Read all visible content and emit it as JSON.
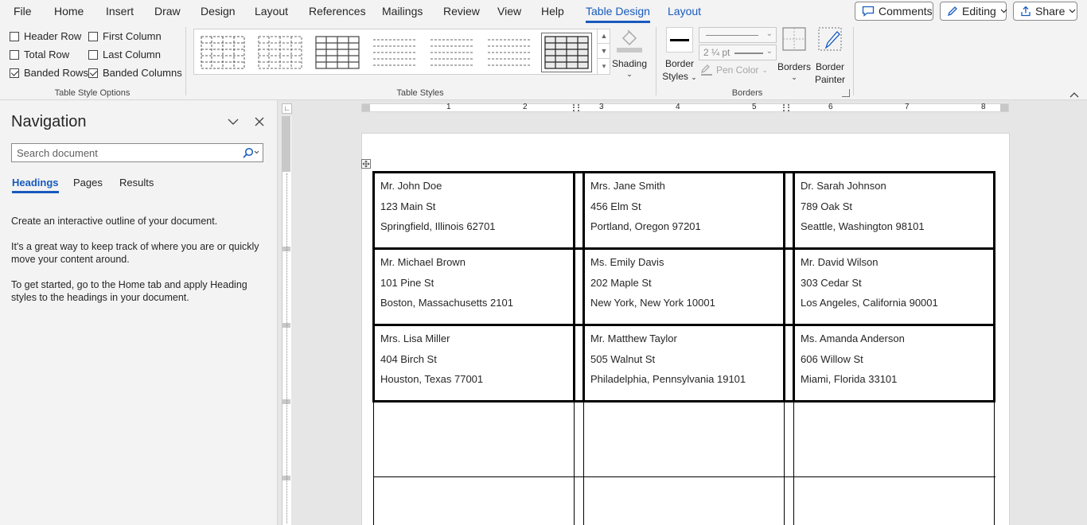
{
  "menu": {
    "items": [
      "File",
      "Home",
      "Insert",
      "Draw",
      "Design",
      "Layout",
      "References",
      "Mailings",
      "Review",
      "View",
      "Help",
      "Table Design",
      "Layout"
    ],
    "active_index": 11,
    "comments_label": "Comments",
    "editing_label": "Editing",
    "share_label": "Share"
  },
  "ribbon": {
    "options": [
      {
        "label": "Header Row",
        "checked": false
      },
      {
        "label": "First Column",
        "checked": false
      },
      {
        "label": "Total Row",
        "checked": false
      },
      {
        "label": "Last Column",
        "checked": false
      },
      {
        "label": "Banded Rows",
        "checked": true
      },
      {
        "label": "Banded Columns",
        "checked": true
      }
    ],
    "group_table_style_options": "Table Style Options",
    "group_table_styles": "Table Styles",
    "group_borders": "Borders",
    "shading_label": "Shading",
    "border_styles_line1": "Border",
    "border_styles_line2": "Styles",
    "pen_weight": "2 ¼ pt",
    "pen_color_label": "Pen Color",
    "borders_label": "Borders",
    "border_painter_line1": "Border",
    "border_painter_line2": "Painter"
  },
  "navigation": {
    "title": "Navigation",
    "search_placeholder": "Search document",
    "tabs": [
      "Headings",
      "Pages",
      "Results"
    ],
    "active_tab": "Headings",
    "paragraphs": [
      "Create an interactive outline of your document.",
      "It's a great way to keep track of where you are or quickly move your content around.",
      "To get started, go to the Home tab and apply Heading styles to the headings in your document."
    ]
  },
  "ruler": {
    "numbers": [
      "1",
      "2",
      "3",
      "4",
      "5",
      "6",
      "7",
      "8"
    ]
  },
  "labels": [
    {
      "name": "Mr. John Doe",
      "street": "123 Main St",
      "city": "Springfield, Illinois 62701"
    },
    {
      "name": "Mrs. Jane Smith",
      "street": "456 Elm St",
      "city": "Portland, Oregon 97201"
    },
    {
      "name": "Dr. Sarah Johnson",
      "street": "789 Oak St",
      "city": "Seattle, Washington 98101"
    },
    {
      "name": "Mr. Michael Brown",
      "street": "101 Pine St",
      "city": "Boston, Massachusetts 2101"
    },
    {
      "name": "Ms. Emily Davis",
      "street": "202 Maple St",
      "city": "New York, New York 10001"
    },
    {
      "name": "Mr. David Wilson",
      "street": "303 Cedar St",
      "city": "Los Angeles, California 90001"
    },
    {
      "name": "Mrs. Lisa Miller",
      "street": "404 Birch St",
      "city": "Houston, Texas 77001"
    },
    {
      "name": "Mr. Matthew Taylor",
      "street": "505 Walnut St",
      "city": "Philadelphia, Pennsylvania 19101"
    },
    {
      "name": "Ms. Amanda Anderson",
      "street": "606 Willow St",
      "city": "Miami, Florida 33101"
    }
  ],
  "colors": {
    "accent": "#185abd",
    "ribbon_bg": "#f3f3f3",
    "workspace_bg": "#e6e6e6"
  }
}
